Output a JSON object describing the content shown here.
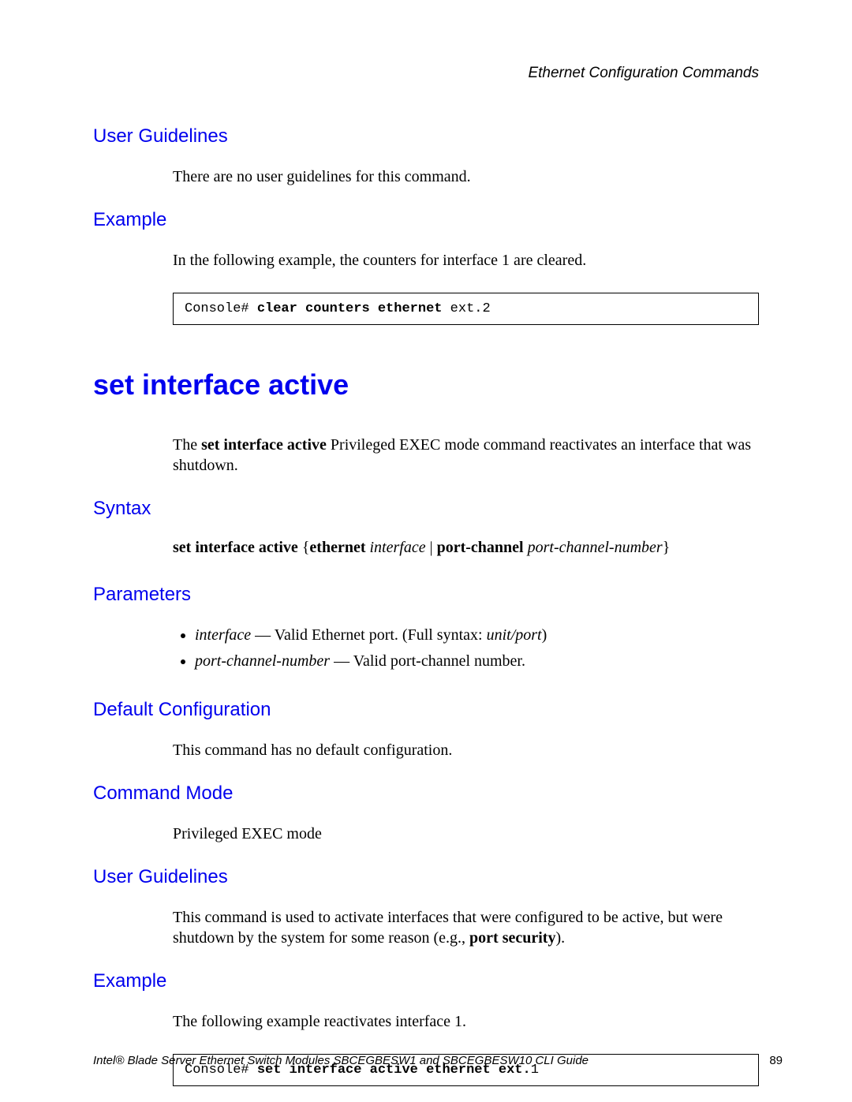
{
  "header": {
    "section": "Ethernet Configuration Commands"
  },
  "sections": {
    "user_guidelines_1": {
      "heading": "User Guidelines",
      "body": "There are no user guidelines for this command."
    },
    "example_1": {
      "heading": "Example",
      "body": "In the following example, the counters for interface 1 are cleared.",
      "code_prompt": "Console# ",
      "code_cmd": "clear counters ethernet ",
      "code_arg": "ext.2"
    },
    "command_title": "set interface active",
    "command_desc_pre": "The ",
    "command_desc_bold": "set interface active",
    "command_desc_post": " Privileged EXEC mode command reactivates an interface that was shutdown.",
    "syntax": {
      "heading": "Syntax",
      "s1": "set interface active ",
      "s2": "{",
      "s3": "ethernet ",
      "s4": "interface",
      "s5": " | ",
      "s6": "port-channel ",
      "s7": "port-channel-number",
      "s8": "}"
    },
    "parameters": {
      "heading": "Parameters",
      "p1_term": "interface",
      "p1_dash": " — ",
      "p1_desc": "Valid Ethernet port. (Full syntax: ",
      "p1_syn": "unit/port",
      "p1_close": ")",
      "p2_term": "port-channel-number",
      "p2_dash": " — ",
      "p2_desc": "Valid port-channel number."
    },
    "default_config": {
      "heading": "Default Configuration",
      "body": "This command has no default configuration."
    },
    "command_mode": {
      "heading": "Command Mode",
      "body": "Privileged EXEC mode"
    },
    "user_guidelines_2": {
      "heading": "User Guidelines",
      "body_pre": "This command is used to activate interfaces that were configured to be active, but were shutdown by the system for some reason (e.g., ",
      "body_bold": "port security",
      "body_post": ")."
    },
    "example_2": {
      "heading": "Example",
      "body": "The following example reactivates interface 1.",
      "code_prompt": "Console# ",
      "code_cmd": "set interface active ethernet ext.",
      "code_arg": "1"
    }
  },
  "footer": {
    "title": "Intel® Blade Server Ethernet Switch Modules SBCEGBESW1 and SBCEGBESW10 CLI Guide",
    "page": "89"
  }
}
